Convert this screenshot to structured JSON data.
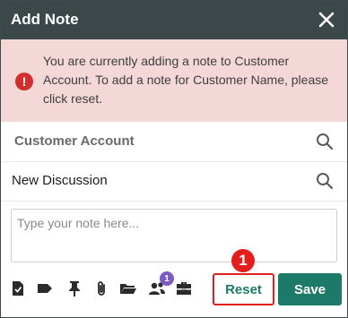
{
  "header": {
    "title": "Add Note",
    "close_icon": "close-icon"
  },
  "alert": {
    "icon": "exclamation-icon",
    "icon_glyph": "!",
    "message": "You are currently adding a note to Customer Account. To add a note for Customer Name, please click reset."
  },
  "fields": {
    "customer": {
      "label": "Customer Account",
      "icon": "search-icon"
    },
    "discussion": {
      "label": "New Discussion",
      "icon": "search-icon"
    }
  },
  "note": {
    "placeholder": "Type your note here...",
    "value": ""
  },
  "toolbar": {
    "icons": [
      "task-check-icon",
      "tag-icon",
      "pin-icon",
      "paperclip-icon",
      "folder-icon",
      "users-icon",
      "briefcase-icon"
    ],
    "users_badge": "1"
  },
  "actions": {
    "reset_label": "Reset",
    "save_label": "Save"
  },
  "annotation": {
    "step_number": "1"
  },
  "colors": {
    "header_bg": "#3b4748",
    "alert_bg": "#f3d8d7",
    "alert_icon": "#d12f2f",
    "primary": "#1d7a69",
    "highlight": "#e02020",
    "badge": "#7b5ac1"
  }
}
